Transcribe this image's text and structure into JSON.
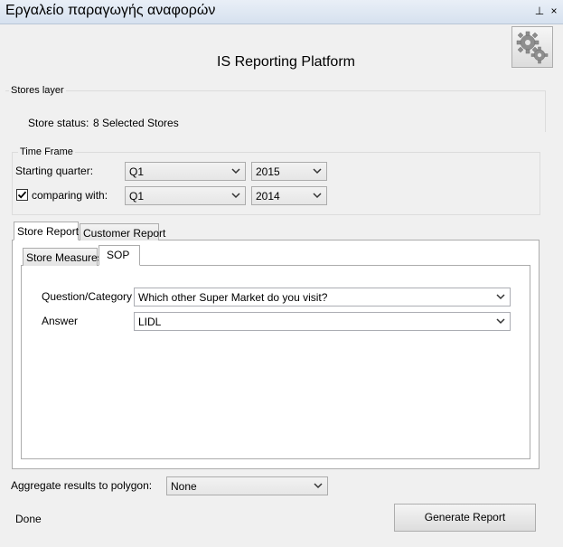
{
  "window": {
    "title": "Εργαλείο παραγωγής αναφορών",
    "pin_glyph": "⊥",
    "close_glyph": "×"
  },
  "header": {
    "app_title": "IS Reporting Platform",
    "settings_icon": "gears-icon"
  },
  "stores_layer": {
    "group_label": "Stores layer",
    "status_label": "Store status:",
    "status_value": "8 Selected Stores"
  },
  "time_frame": {
    "group_label": "Time Frame",
    "starting_label": "Starting quarter:",
    "starting_quarter": "Q1",
    "starting_year": "2015",
    "comparing_label": "comparing with:",
    "comparing_checked": true,
    "comparing_quarter": "Q1",
    "comparing_year": "2014"
  },
  "tabs": {
    "outer": [
      "Store Report",
      "Customer Report"
    ],
    "inner": [
      "Store Measures",
      "SOP"
    ]
  },
  "sop": {
    "question_label": "Question/Category",
    "question_value": "Which other Super Market  do you visit?",
    "answer_label": "Answer",
    "answer_value": "LIDL"
  },
  "aggregate": {
    "label": "Aggregate results to polygon:",
    "value": "None"
  },
  "footer": {
    "status": "Done",
    "generate_label": "Generate Report"
  },
  "colors": {
    "background": "#f0f0f0",
    "border": "#acacac"
  }
}
